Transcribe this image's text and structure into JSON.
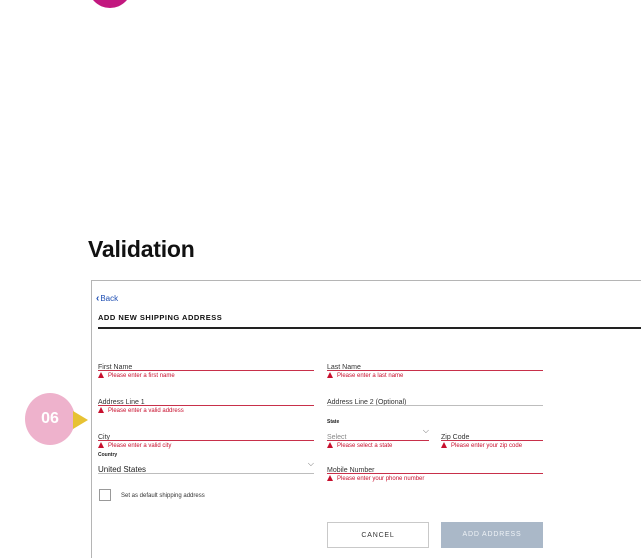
{
  "section_title": "Validation",
  "callout": {
    "label": "06"
  },
  "colors": {
    "accent": "#c2187f",
    "error": "#c8102e",
    "callout_fill": "#eeb2cc",
    "callout_arrow": "#e7c233",
    "disabled_button": "#aab8c8"
  },
  "form": {
    "back_label": "Back",
    "title": "ADD NEW SHIPPING ADDRESS",
    "fields": {
      "first_name": {
        "label": "First Name",
        "error": "Please enter a first name"
      },
      "last_name": {
        "label": "Last Name",
        "error": "Please enter a last name"
      },
      "address_line_1": {
        "label": "Address Line 1",
        "error": "Please enter a valid address"
      },
      "address_line_2": {
        "label": "Address Line 2 (Optional)"
      },
      "city": {
        "label": "City",
        "error": "Please enter a valid city"
      },
      "state": {
        "label": "State",
        "placeholder": "Select",
        "error": "Please select a state"
      },
      "zip_code": {
        "label": "Zip Code",
        "error": "Please enter your zip code"
      },
      "country": {
        "label": "Country",
        "value": "United States"
      },
      "mobile_number": {
        "label": "Mobile Number",
        "error": "Please enter your phone number"
      }
    },
    "default_checkbox_label": "Set as default shipping address",
    "cancel_label": "CANCEL",
    "submit_label": "ADD ADDRESS"
  }
}
